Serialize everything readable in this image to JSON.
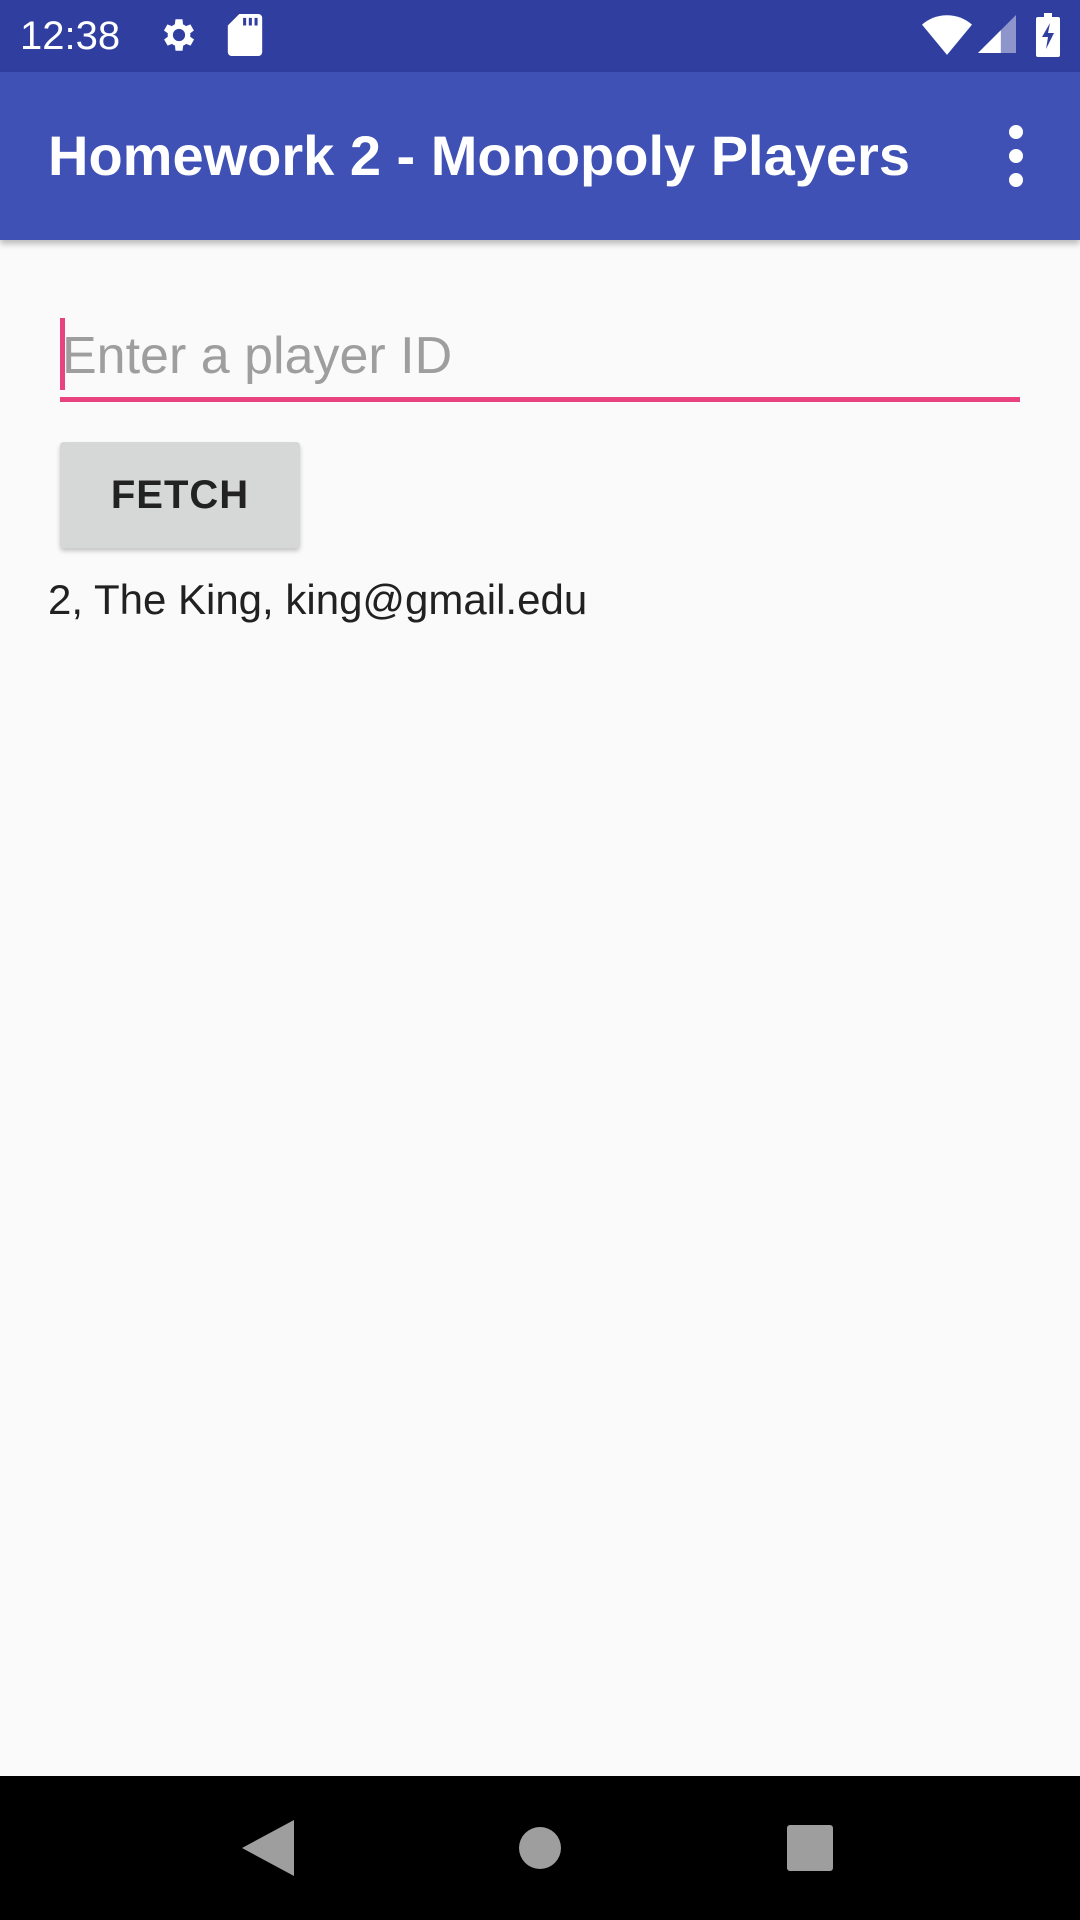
{
  "status_bar": {
    "time": "12:38",
    "left_icons": [
      "gear-icon",
      "sd-card-icon"
    ],
    "right_icons": [
      "wifi-icon",
      "cell-signal-icon",
      "battery-charging-icon"
    ],
    "color": "#303f9f"
  },
  "app_bar": {
    "title": "Homework 2 - Monopoly Players",
    "menu_icon": "overflow-menu-icon",
    "color": "#3f51b5"
  },
  "main": {
    "player_id_input": {
      "value": "",
      "placeholder": "Enter a player ID",
      "accent_color": "#e9437f"
    },
    "fetch_button": {
      "label": "FETCH"
    },
    "result": "2, The King, king@gmail.edu"
  },
  "nav_bar": {
    "buttons": [
      "back-icon",
      "home-icon",
      "recents-icon"
    ]
  }
}
